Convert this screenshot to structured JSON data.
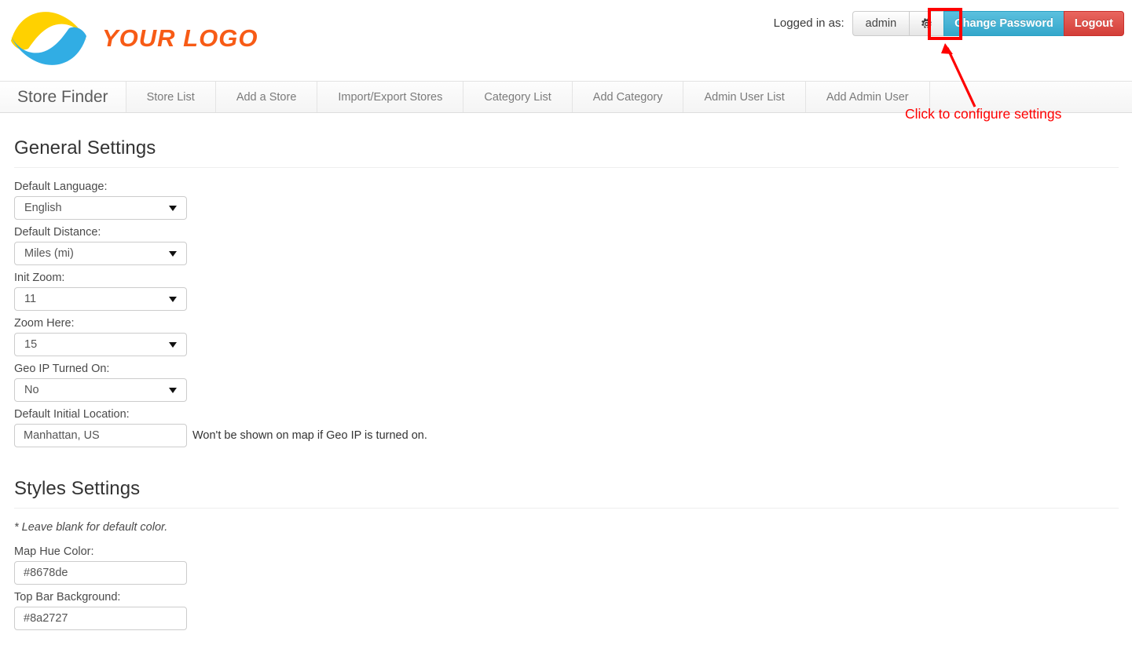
{
  "header": {
    "logo": {
      "mark_name": "wave-swoosh-logo",
      "text": "YOUR LOGO",
      "color_top": "#ffd100",
      "color_bottom": "#31ade4",
      "text_color": "#f75b16"
    },
    "account": {
      "logged_in_label": "Logged in as:",
      "username": "admin",
      "gear_icon": "gear-icon",
      "change_password_label": "Change Password",
      "logout_label": "Logout",
      "info_color": "#5bc0de",
      "danger_color": "#d33e38"
    }
  },
  "nav": {
    "brand": "Store Finder",
    "items": [
      {
        "label": "Store List"
      },
      {
        "label": "Add a Store"
      },
      {
        "label": "Import/Export Stores"
      },
      {
        "label": "Category List"
      },
      {
        "label": "Add Category"
      },
      {
        "label": "Admin User List"
      },
      {
        "label": "Add Admin User"
      }
    ]
  },
  "annotation": {
    "text": "Click to configure settings",
    "color": "#fe0000"
  },
  "general_settings": {
    "title": "General Settings",
    "fields": [
      {
        "label": "Default Language:",
        "value": "English",
        "type": "select"
      },
      {
        "label": "Default Distance:",
        "value": "Miles (mi)",
        "type": "select"
      },
      {
        "label": "Init Zoom:",
        "value": "11",
        "type": "select"
      },
      {
        "label": "Zoom Here:",
        "value": "15",
        "type": "select"
      },
      {
        "label": "Geo IP Turned On:",
        "value": "No",
        "type": "select"
      },
      {
        "label": "Default Initial Location:",
        "value": "Manhattan, US",
        "type": "text",
        "help": "Won't be shown on map if Geo IP is turned on."
      }
    ]
  },
  "styles_settings": {
    "title": "Styles Settings",
    "note": "* Leave blank for default color.",
    "fields": [
      {
        "label": "Map Hue Color:",
        "value": "#8678de",
        "type": "text"
      },
      {
        "label": "Top Bar Background:",
        "value": "#8a2727",
        "type": "text"
      }
    ]
  }
}
